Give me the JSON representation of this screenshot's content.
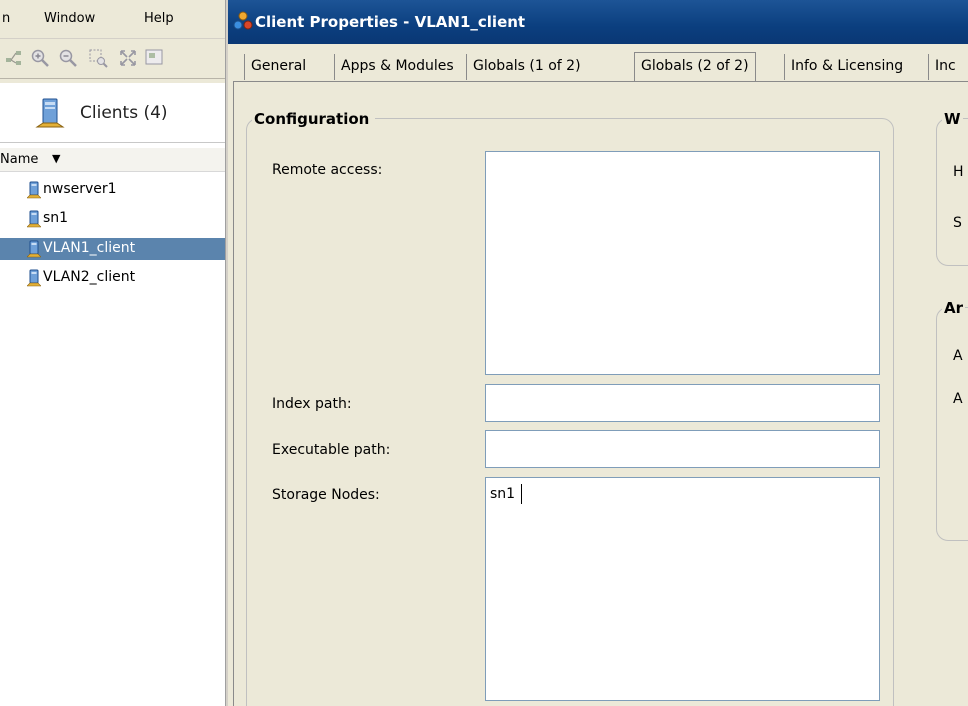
{
  "menu": {
    "partial_item": "n",
    "window_label": "Window",
    "help_label": "Help"
  },
  "toolbar": {
    "icons": [
      "network-map-icon",
      "zoom-in-icon",
      "zoom-out-icon",
      "zoom-region-icon",
      "fit-view-icon",
      "overview-icon"
    ]
  },
  "tree": {
    "header_title": "Clients (4)",
    "column_label": "Name",
    "sort_indicator": "▼",
    "clients": [
      {
        "label": "nwserver1",
        "selected": false
      },
      {
        "label": "sn1",
        "selected": false
      },
      {
        "label": "VLAN1_client",
        "selected": true
      },
      {
        "label": "VLAN2_client",
        "selected": false
      }
    ]
  },
  "dialog": {
    "title": "Client Properties - VLAN1_client",
    "tabs": [
      {
        "label": "General",
        "active": false
      },
      {
        "label": "Apps & Modules",
        "active": false
      },
      {
        "label": "Globals (1 of 2)",
        "active": false
      },
      {
        "label": "Globals (2 of 2)",
        "active": true
      },
      {
        "label": "Info & Licensing",
        "active": false
      },
      {
        "label": "Inc",
        "active": false
      }
    ],
    "configuration": {
      "legend": "Configuration",
      "remote_access_label": "Remote access:",
      "remote_access_value": "",
      "index_path_label": "Index path:",
      "index_path_value": "",
      "executable_path_label": "Executable path:",
      "executable_path_value": "",
      "storage_nodes_label": "Storage Nodes:",
      "storage_nodes_value": "sn1"
    },
    "right_group1": {
      "legend": "W",
      "label1": "H",
      "label2": "S"
    },
    "right_group2": {
      "legend": "Ar",
      "label1": "A",
      "label2": "A"
    }
  },
  "colors": {
    "selection": "#5b84ad",
    "titlebar": "#0b3f7f",
    "panel": "#ece9d8",
    "field_border": "#7f9db9"
  }
}
